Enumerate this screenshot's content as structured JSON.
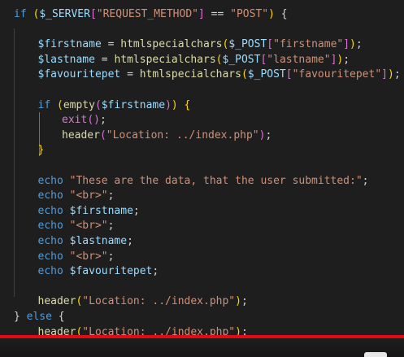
{
  "editor": {
    "lines": [
      {
        "indent": 0,
        "tokens": [
          {
            "t": "if ",
            "c": "kw"
          },
          {
            "t": "(",
            "c": "br1"
          },
          {
            "t": "$_SERVER",
            "c": "var"
          },
          {
            "t": "[",
            "c": "br2"
          },
          {
            "t": "\"REQUEST_METHOD\"",
            "c": "str"
          },
          {
            "t": "]",
            "c": "br2"
          },
          {
            "t": " == ",
            "c": "pn"
          },
          {
            "t": "\"POST\"",
            "c": "str"
          },
          {
            "t": ")",
            "c": "br1"
          },
          {
            "t": " {",
            "c": "pn"
          }
        ]
      },
      {
        "indent": 0,
        "tokens": []
      },
      {
        "indent": 1,
        "tokens": [
          {
            "t": "$firstname",
            "c": "var"
          },
          {
            "t": " = ",
            "c": "pn"
          },
          {
            "t": "htmlspecialchars",
            "c": "fn"
          },
          {
            "t": "(",
            "c": "br1"
          },
          {
            "t": "$_POST",
            "c": "var"
          },
          {
            "t": "[",
            "c": "br2"
          },
          {
            "t": "\"firstname\"",
            "c": "str"
          },
          {
            "t": "]",
            "c": "br2"
          },
          {
            "t": ")",
            "c": "br1"
          },
          {
            "t": ";",
            "c": "pn"
          }
        ]
      },
      {
        "indent": 1,
        "tokens": [
          {
            "t": "$lastname",
            "c": "var"
          },
          {
            "t": " = ",
            "c": "pn"
          },
          {
            "t": "htmlspecialchars",
            "c": "fn"
          },
          {
            "t": "(",
            "c": "br1"
          },
          {
            "t": "$_POST",
            "c": "var"
          },
          {
            "t": "[",
            "c": "br2"
          },
          {
            "t": "\"lastname\"",
            "c": "str"
          },
          {
            "t": "]",
            "c": "br2"
          },
          {
            "t": ")",
            "c": "br1"
          },
          {
            "t": ";",
            "c": "pn"
          }
        ]
      },
      {
        "indent": 1,
        "tokens": [
          {
            "t": "$favouritepet",
            "c": "var"
          },
          {
            "t": " = ",
            "c": "pn"
          },
          {
            "t": "htmlspecialchars",
            "c": "fn"
          },
          {
            "t": "(",
            "c": "br1"
          },
          {
            "t": "$_POST",
            "c": "var"
          },
          {
            "t": "[",
            "c": "br2"
          },
          {
            "t": "\"favouritepet\"",
            "c": "str"
          },
          {
            "t": "]",
            "c": "br2"
          },
          {
            "t": ")",
            "c": "br1"
          },
          {
            "t": ";",
            "c": "pn"
          }
        ]
      },
      {
        "indent": 0,
        "tokens": []
      },
      {
        "indent": 1,
        "tokens": [
          {
            "t": "if ",
            "c": "kw"
          },
          {
            "t": "(",
            "c": "br1"
          },
          {
            "t": "empty",
            "c": "fn"
          },
          {
            "t": "(",
            "c": "br2"
          },
          {
            "t": "$firstname",
            "c": "var"
          },
          {
            "t": ")",
            "c": "br2"
          },
          {
            "t": ")",
            "c": "br1"
          },
          {
            "t": " ",
            "c": "pn"
          },
          {
            "t": "{",
            "c": "br1"
          }
        ]
      },
      {
        "indent": 2,
        "tokens": [
          {
            "t": "exit",
            "c": "ctl"
          },
          {
            "t": "()",
            "c": "br2"
          },
          {
            "t": ";",
            "c": "pn"
          }
        ]
      },
      {
        "indent": 2,
        "tokens": [
          {
            "t": "header",
            "c": "fn"
          },
          {
            "t": "(",
            "c": "br2"
          },
          {
            "t": "\"Location: ../index.php\"",
            "c": "str"
          },
          {
            "t": ")",
            "c": "br2"
          },
          {
            "t": ";",
            "c": "pn"
          }
        ]
      },
      {
        "indent": 1,
        "tokens": [
          {
            "t": "}",
            "c": "br1"
          }
        ]
      },
      {
        "indent": 0,
        "tokens": []
      },
      {
        "indent": 1,
        "tokens": [
          {
            "t": "echo ",
            "c": "kw2"
          },
          {
            "t": "\"These are the data, that the user submitted:\"",
            "c": "str"
          },
          {
            "t": ";",
            "c": "pn"
          }
        ]
      },
      {
        "indent": 1,
        "tokens": [
          {
            "t": "echo ",
            "c": "kw2"
          },
          {
            "t": "\"<br>\"",
            "c": "str"
          },
          {
            "t": ";",
            "c": "pn"
          }
        ]
      },
      {
        "indent": 1,
        "tokens": [
          {
            "t": "echo ",
            "c": "kw2"
          },
          {
            "t": "$firstname",
            "c": "var"
          },
          {
            "t": ";",
            "c": "pn"
          }
        ]
      },
      {
        "indent": 1,
        "tokens": [
          {
            "t": "echo ",
            "c": "kw2"
          },
          {
            "t": "\"<br>\"",
            "c": "str"
          },
          {
            "t": ";",
            "c": "pn"
          }
        ]
      },
      {
        "indent": 1,
        "tokens": [
          {
            "t": "echo ",
            "c": "kw2"
          },
          {
            "t": "$lastname",
            "c": "var"
          },
          {
            "t": ";",
            "c": "pn"
          }
        ]
      },
      {
        "indent": 1,
        "tokens": [
          {
            "t": "echo ",
            "c": "kw2"
          },
          {
            "t": "\"<br>\"",
            "c": "str"
          },
          {
            "t": ";",
            "c": "pn"
          }
        ]
      },
      {
        "indent": 1,
        "tokens": [
          {
            "t": "echo ",
            "c": "kw2"
          },
          {
            "t": "$favouritepet",
            "c": "var"
          },
          {
            "t": ";",
            "c": "pn"
          }
        ]
      },
      {
        "indent": 0,
        "tokens": []
      },
      {
        "indent": 1,
        "tokens": [
          {
            "t": "header",
            "c": "fn"
          },
          {
            "t": "(",
            "c": "br1"
          },
          {
            "t": "\"Location: ../index.php\"",
            "c": "str"
          },
          {
            "t": ")",
            "c": "br1"
          },
          {
            "t": ";",
            "c": "pn"
          }
        ]
      },
      {
        "indent": 0,
        "tokens": [
          {
            "t": "}",
            "c": "pn"
          },
          {
            "t": " else ",
            "c": "kw"
          },
          {
            "t": "{",
            "c": "pn"
          }
        ]
      },
      {
        "indent": 1,
        "tokens": [
          {
            "t": "header",
            "c": "fn"
          },
          {
            "t": "(",
            "c": "br1"
          },
          {
            "t": "\"Location: ../index.php\"",
            "c": "str"
          },
          {
            "t": ")",
            "c": "br1"
          },
          {
            "t": ";",
            "c": "pn"
          }
        ]
      },
      {
        "indent": 0,
        "tokens": [
          {
            "t": "}",
            "c": "pn"
          }
        ]
      }
    ]
  },
  "video_progress": {
    "color": "#e50914"
  }
}
